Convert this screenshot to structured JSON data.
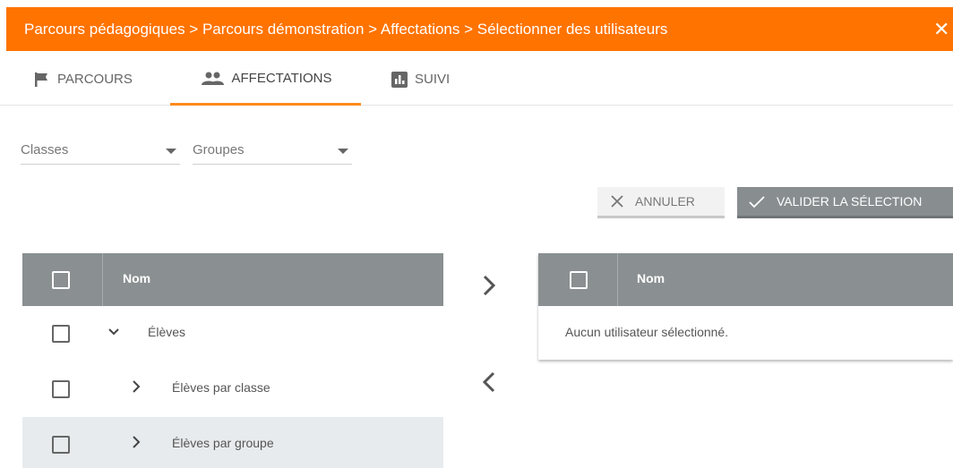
{
  "topbar": {
    "breadcrumb": "Parcours pédagogiques > Parcours démonstration > Affectations > Sélectionner des utilisateurs",
    "close_glyph": "✕"
  },
  "tabs": [
    {
      "label": "PARCOURS",
      "icon": "flag-icon",
      "active": false
    },
    {
      "label": "AFFECTATIONS",
      "icon": "people-icon",
      "active": true
    },
    {
      "label": "SUIVI",
      "icon": "bar-chart-icon",
      "active": false
    }
  ],
  "filters": {
    "classes": {
      "label": "Classes"
    },
    "groupes": {
      "label": "Groupes"
    }
  },
  "actions": {
    "cancel_label": "ANNULER",
    "validate_label": "VALIDER LA SÉLECTION"
  },
  "left_table": {
    "header": "Nom",
    "rows": [
      {
        "label": "Élèves",
        "chevron": "chevron-down-icon",
        "level": 0
      },
      {
        "label": "Élèves par classe",
        "chevron": "chevron-right-icon",
        "level": 1
      },
      {
        "label": "Élèves par groupe",
        "chevron": "chevron-right-icon",
        "level": 1,
        "highlighted": true
      }
    ]
  },
  "right_table": {
    "header": "Nom",
    "empty_message": "Aucun utilisateur sélectionné."
  },
  "colors": {
    "topbar": "#ff7300",
    "tab_active_underline": "#ff8a1a",
    "table_header": "#8a8f91",
    "validate_button": "#888e90",
    "row_highlight": "#e8ebed"
  }
}
